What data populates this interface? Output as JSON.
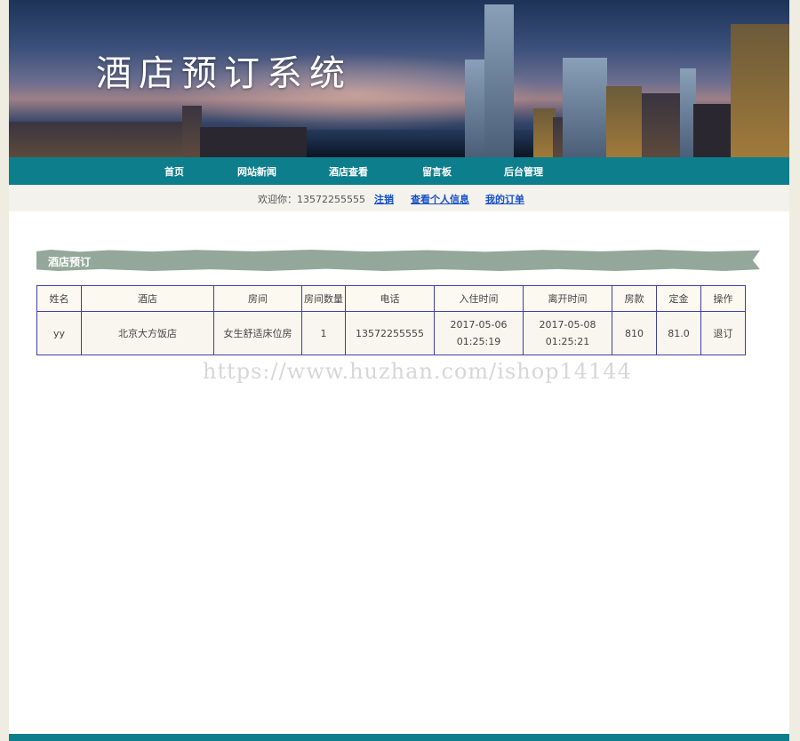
{
  "banner": {
    "title": "酒店预订系统"
  },
  "nav": {
    "items": [
      "首页",
      "网站新闻",
      "酒店查看",
      "留言板",
      "后台管理"
    ]
  },
  "userbar": {
    "welcome": "欢迎你：13572255555",
    "logout": "注销",
    "profile": "查看个人信息",
    "orders": "我的订单"
  },
  "section": {
    "title": "酒店预订"
  },
  "table": {
    "headers": [
      "姓名",
      "酒店",
      "房间",
      "房间数量",
      "电话",
      "入住时间",
      "离开时间",
      "房款",
      "定金",
      "操作"
    ],
    "rows": [
      {
        "name": "yy",
        "hotel": "北京大方饭店",
        "room": "女生舒适床位房",
        "count": "1",
        "phone": "13572255555",
        "checkin_date": "2017-05-06",
        "checkin_time": "01:25:19",
        "checkout_date": "2017-05-08",
        "checkout_time": "01:25:21",
        "price": "810",
        "deposit": "81.0",
        "action": "退订"
      }
    ]
  },
  "watermark": "https://www.huzhan.com/ishop14144",
  "colors": {
    "nav": "#0d7e8c",
    "link": "#1650c8",
    "table_border": "#3f3fa8",
    "section": "#93a89a"
  }
}
